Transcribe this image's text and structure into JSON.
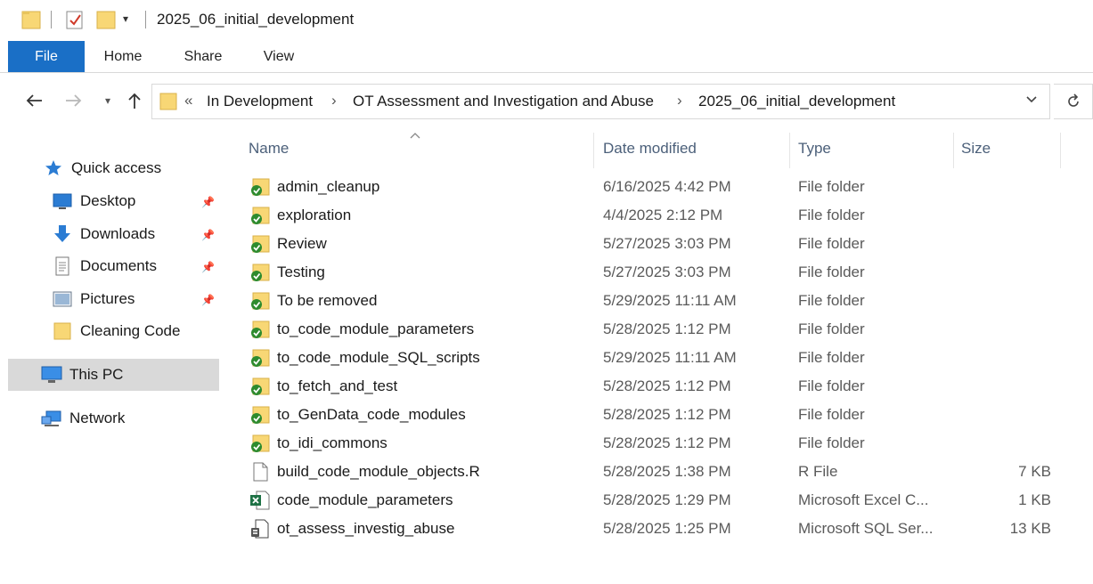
{
  "window": {
    "title": "2025_06_initial_development"
  },
  "ribbon": {
    "tabs": [
      "File",
      "Home",
      "Share",
      "View"
    ]
  },
  "address": {
    "overflow": "«",
    "crumbs": [
      "In Development",
      "OT Assessment and Investigation and Abuse",
      "2025_06_initial_development"
    ]
  },
  "navpane": {
    "quick_access": "Quick access",
    "pinned": [
      "Desktop",
      "Downloads",
      "Documents",
      "Pictures"
    ],
    "folder": "Cleaning Code",
    "this_pc": "This PC",
    "network": "Network"
  },
  "columns": {
    "name": "Name",
    "date": "Date modified",
    "type": "Type",
    "size": "Size"
  },
  "files": [
    {
      "name": "admin_cleanup",
      "date": "6/16/2025 4:42 PM",
      "type": "File folder",
      "size": "",
      "icon": "synced-folder-icon"
    },
    {
      "name": "exploration",
      "date": "4/4/2025 2:12 PM",
      "type": "File folder",
      "size": "",
      "icon": "synced-folder-icon"
    },
    {
      "name": "Review",
      "date": "5/27/2025 3:03 PM",
      "type": "File folder",
      "size": "",
      "icon": "synced-folder-icon"
    },
    {
      "name": "Testing",
      "date": "5/27/2025 3:03 PM",
      "type": "File folder",
      "size": "",
      "icon": "synced-folder-icon"
    },
    {
      "name": "To be removed",
      "date": "5/29/2025 11:11 AM",
      "type": "File folder",
      "size": "",
      "icon": "synced-folder-icon"
    },
    {
      "name": "to_code_module_parameters",
      "date": "5/28/2025 1:12 PM",
      "type": "File folder",
      "size": "",
      "icon": "synced-folder-icon"
    },
    {
      "name": "to_code_module_SQL_scripts",
      "date": "5/29/2025 11:11 AM",
      "type": "File folder",
      "size": "",
      "icon": "synced-folder-icon"
    },
    {
      "name": "to_fetch_and_test",
      "date": "5/28/2025 1:12 PM",
      "type": "File folder",
      "size": "",
      "icon": "synced-folder-icon"
    },
    {
      "name": "to_GenData_code_modules",
      "date": "5/28/2025 1:12 PM",
      "type": "File folder",
      "size": "",
      "icon": "synced-folder-icon"
    },
    {
      "name": "to_idi_commons",
      "date": "5/28/2025 1:12 PM",
      "type": "File folder",
      "size": "",
      "icon": "synced-folder-icon"
    },
    {
      "name": "build_code_module_objects.R",
      "date": "5/28/2025 1:38 PM",
      "type": "R File",
      "size": "7 KB",
      "icon": "document-icon"
    },
    {
      "name": "code_module_parameters",
      "date": "5/28/2025 1:29 PM",
      "type": "Microsoft Excel C...",
      "size": "1 KB",
      "icon": "excel-icon"
    },
    {
      "name": "ot_assess_investig_abuse",
      "date": "5/28/2025 1:25 PM",
      "type": "Microsoft SQL Ser...",
      "size": "13 KB",
      "icon": "sql-file-icon"
    }
  ],
  "colors": {
    "file_tab": "#1a6fc6",
    "folder_yellow": "#f8d775",
    "sync_green": "#2e8b2e",
    "selection_gray": "#d9d9d9"
  }
}
